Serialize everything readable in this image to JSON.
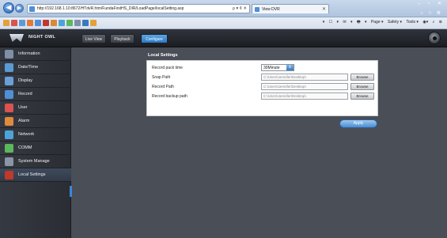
{
  "browser": {
    "url": "http://192.168.1.10:8672/HTdvR.htm/FundaFirstHS_DIR/LoadPage/localSetting.asp",
    "address_icons": "ρ ▾ ¢ ✕",
    "tab_title": "View DVR",
    "tab_close": "✕",
    "window_controls": "– ▫ ✕",
    "right_icons": "⌂ ☆ ⚙",
    "back_icon": "◀",
    "forward_icon": "▶",
    "commands": [
      "▾",
      "☐",
      "▾",
      "✉",
      "▾",
      "🖶",
      "▾",
      "Page ▾",
      "Safety ▾",
      "Tools ▾",
      "◉▾",
      "⌕",
      "⊕"
    ]
  },
  "app": {
    "logo_text": "NIGHT OWL",
    "top_buttons": [
      "Live View",
      "Playback",
      "Configure"
    ],
    "active_top_button": "Configure"
  },
  "sidebar": {
    "items": [
      {
        "label": "Information",
        "icon": "info-icon",
        "color": "#7f8fa6"
      },
      {
        "label": "Date/Time",
        "icon": "clock-icon",
        "color": "#5b9bd5"
      },
      {
        "label": "Display",
        "icon": "monitor-icon",
        "color": "#6aa0d8"
      },
      {
        "label": "Record",
        "icon": "record-icon",
        "color": "#4f8fd6"
      },
      {
        "label": "User",
        "icon": "user-icon",
        "color": "#d9534f"
      },
      {
        "label": "Alarm",
        "icon": "alarm-icon",
        "color": "#e08a3c"
      },
      {
        "label": "Network",
        "icon": "network-icon",
        "color": "#4da3d9"
      },
      {
        "label": "COMM",
        "icon": "comm-icon",
        "color": "#5cb85c"
      },
      {
        "label": "System Manage",
        "icon": "system-icon",
        "color": "#8a95a5"
      },
      {
        "label": "Local Settings",
        "icon": "local-settings-icon",
        "color": "#c0392b"
      }
    ],
    "active_item": "Local Settings"
  },
  "local_settings": {
    "title": "Local Settings",
    "rows": [
      {
        "label": "Record pack time",
        "type": "select",
        "value": "30Minute"
      },
      {
        "label": "Snap Path",
        "type": "path",
        "value": "C:\\Users\\Jennifer\\Desktop\\"
      },
      {
        "label": "Record Path",
        "type": "path",
        "value": "C:\\Users\\Jennifer\\Desktop\\"
      },
      {
        "label": "Record backup path",
        "type": "path",
        "value": "C:\\Users\\Jennifer\\Desktop\\"
      }
    ],
    "browse_label": "Browse",
    "apply_label": "Apply",
    "select_arrow": "⇕"
  }
}
